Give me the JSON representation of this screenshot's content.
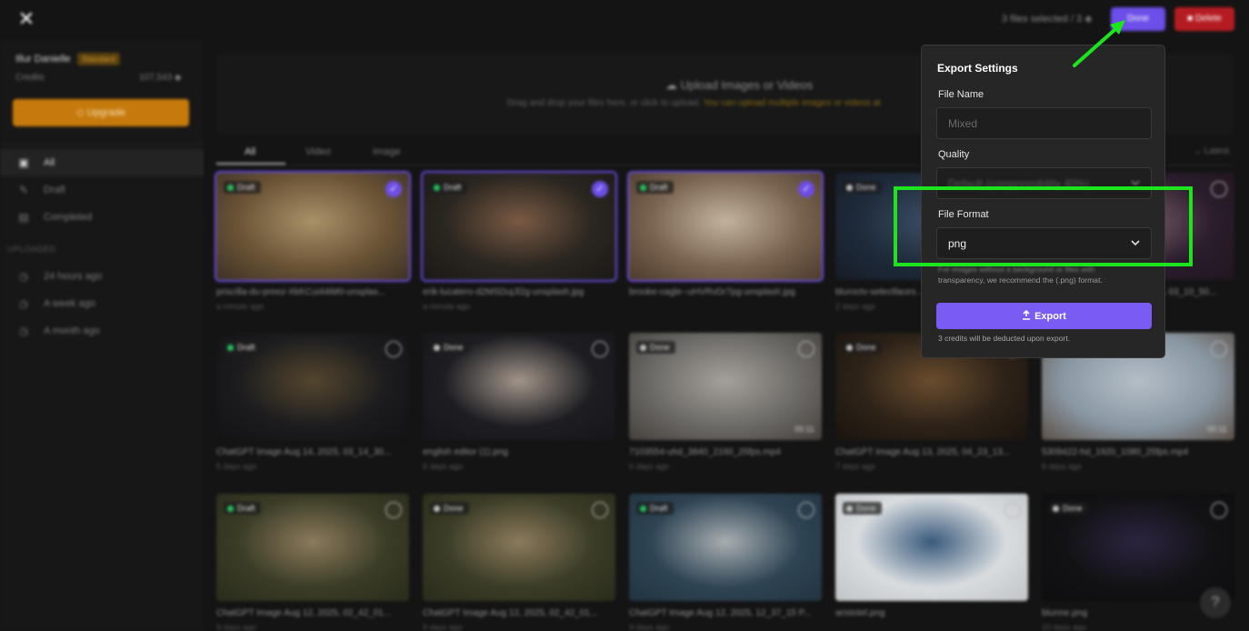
{
  "header": {
    "close_icon": "close-icon",
    "selection_count": "3 files selected  /  3 ◈",
    "done_label": "Done",
    "delete_label": "Delete"
  },
  "sidebar": {
    "user_name": "Illur Danielle",
    "plan": "Standard",
    "credits_label": "Credits",
    "credits_value": "107,543 ◆",
    "upgrade_label": "Upgrade",
    "nav": [
      {
        "label": "All",
        "icon": "gallery-icon",
        "active": true
      },
      {
        "label": "Draft",
        "icon": "pencil-icon"
      },
      {
        "label": "Completed",
        "icon": "document-icon"
      }
    ],
    "uploaded_title": "UPLOADED",
    "uploaded": [
      {
        "label": "24 hours ago",
        "icon": "clock-icon"
      },
      {
        "label": "A week ago",
        "icon": "clock-icon"
      },
      {
        "label": "A month ago",
        "icon": "clock-icon"
      }
    ]
  },
  "upload": {
    "title": "Upload Images or Videos",
    "subtitle": "Drag and drop your files here, or click to upload.",
    "subtitle_highlight": "You can upload multiple images or videos at"
  },
  "tabs": [
    "All",
    "Video",
    "Image"
  ],
  "sort_label": "Latest",
  "files": [
    {
      "name": "priscilla-du-preez-XkKCui44iM0-unsplas...",
      "date": "a minute ago",
      "status": "Draft",
      "selected": true,
      "colors": [
        "#6b5436",
        "#a89168",
        "#3c3026"
      ]
    },
    {
      "name": "erik-lucatero-d2MSDujJl2g-unsplash.jpg",
      "date": "a minute ago",
      "status": "Draft",
      "selected": true,
      "colors": [
        "#2a2620",
        "#7a5a44",
        "#1a1816"
      ]
    },
    {
      "name": "brooke-cagle--uHVRvDr7pg-unsplash.jpg",
      "date": "",
      "status": "Draft",
      "selected": true,
      "colors": [
        "#7a6450",
        "#c2b39c",
        "#4c3a2c"
      ]
    },
    {
      "name": "bluroctv-selectfaces...",
      "date": "2 days ago",
      "status": "Done",
      "selected": false,
      "colors": [
        "#1e2a3a",
        "#3c4e66",
        "#161c26"
      ]
    },
    {
      "name": "ChatGPT Image Aug 15, 2025, 03_10_50...",
      "date": "",
      "status": "",
      "selected": false,
      "colors": [
        "#2a1d2c",
        "#7a5d6c",
        "#20161f"
      ]
    },
    {
      "name": "ChatGPT Image Aug 14, 2025, 03_14_30...",
      "date": "5 days ago",
      "status": "Draft",
      "selected": false,
      "colors": [
        "#1c1c1e",
        "#54462e",
        "#121214"
      ]
    },
    {
      "name": "english editor (1).png",
      "date": "6 days ago",
      "status": "Done",
      "selected": false,
      "colors": [
        "#1e1e22",
        "#a2958a",
        "#16161a"
      ]
    },
    {
      "name": "7103554-uhd_3840_2160_25fps.mp4",
      "date": "6 days ago",
      "status": "Done",
      "selected": false,
      "duration": "00:11",
      "colors": [
        "#6c6a66",
        "#a4a09a",
        "#44403c"
      ]
    },
    {
      "name": "ChatGPT Image Aug 13, 2025, 04_23_13...",
      "date": "7 days ago",
      "status": "Done",
      "selected": false,
      "colors": [
        "#2c2218",
        "#6a4c2e",
        "#1a140e"
      ]
    },
    {
      "name": "5309422-hd_1920_1080_25fps.mp4",
      "date": "8 days ago",
      "status": "",
      "selected": false,
      "duration": "00:11",
      "colors": [
        "#8a98a4",
        "#b5bec6",
        "#5c5046"
      ]
    },
    {
      "name": "ChatGPT Image Aug 12, 2025, 02_42_01...",
      "date": "9 days ago",
      "status": "Draft",
      "selected": false,
      "colors": [
        "#3a3c26",
        "#8c7a5c",
        "#2a2c1c"
      ]
    },
    {
      "name": "ChatGPT Image Aug 12, 2025, 02_42_01...",
      "date": "9 days ago",
      "status": "Done",
      "selected": false,
      "colors": [
        "#3a3c26",
        "#8c7a5c",
        "#2a2c1c"
      ]
    },
    {
      "name": "ChatGPT Image Aug 12, 2025, 12_37_15 P...",
      "date": "9 days ago",
      "status": "Draft",
      "selected": false,
      "colors": [
        "#2e4454",
        "#a8aeb0",
        "#22333f"
      ]
    },
    {
      "name": "aristotel.png",
      "date": "",
      "status": "Done",
      "selected": false,
      "colors": [
        "#d8dcdf",
        "#3a5a7c",
        "#c0c4c6"
      ]
    },
    {
      "name": "blurme.png",
      "date": "10 days ago",
      "status": "Done",
      "selected": false,
      "colors": [
        "#121214",
        "#2c2440",
        "#0e0e10"
      ]
    }
  ],
  "export_settings": {
    "title": "Export Settings",
    "file_name_label": "File Name",
    "file_name_placeholder": "Mixed",
    "quality_label": "Quality",
    "quality_value": "Default (compressibility 40%)",
    "file_format_label": "File Format",
    "file_format_value": "png",
    "hint_blurred": "For images without a background or files with",
    "hint_text": "transparency, we recommend the (.png) format.",
    "export_label": "Export",
    "credits_note": "3 credits will be deducted upon export."
  },
  "help_label": "?",
  "colors": {
    "accent": "#7a5cf5",
    "done_button": "#6c4ee8",
    "delete_button": "#b51c22",
    "upgrade_button": "#c77a0c",
    "annotation": "#1de51d",
    "draft_dot": "#22c55e",
    "done_dot": "#bfbfbf"
  }
}
